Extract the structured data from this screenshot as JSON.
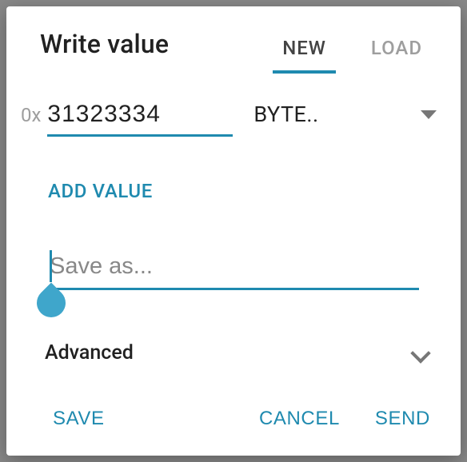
{
  "title": "Write value",
  "tabs": {
    "new": "NEW",
    "load": "LOAD",
    "active": "new"
  },
  "valueRow": {
    "prefix": "0x",
    "value": "31323334",
    "typeLabel": "BYTE.."
  },
  "addValueLabel": "ADD VALUE",
  "saveAs": {
    "placeholder": "Save as...",
    "value": ""
  },
  "advanced": {
    "label": "Advanced"
  },
  "actions": {
    "save": "SAVE",
    "cancel": "CANCEL",
    "send": "SEND"
  },
  "colors": {
    "accent": "#1f8aaf"
  }
}
